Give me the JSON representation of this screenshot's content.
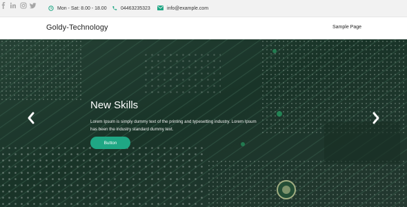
{
  "topbar": {
    "hours": "Mon - Sat: 8.00 - 18.00",
    "phone": "04463235323",
    "email": "info@example.com",
    "icons": [
      "clock-icon",
      "phone-icon",
      "mail-icon"
    ],
    "social": [
      "facebook-icon",
      "linkedin-icon",
      "instagram-icon",
      "twitter-icon"
    ]
  },
  "navbar": {
    "brand": "Goldy-Technology",
    "links": [
      "Sample Page"
    ]
  },
  "hero": {
    "title": "New Skills",
    "text": "Lorem Ipsum is simply dummy text of the printing and typesetting industry. Lorem Ipsum has been the industry standard dummy text.",
    "button": "Button",
    "prev_icon": "chevron-left-icon",
    "next_icon": "chevron-right-icon"
  },
  "colors": {
    "accent": "#1fa784",
    "topbar_bg": "#f2f2f2",
    "hero_bg": "#1e3a2e"
  }
}
